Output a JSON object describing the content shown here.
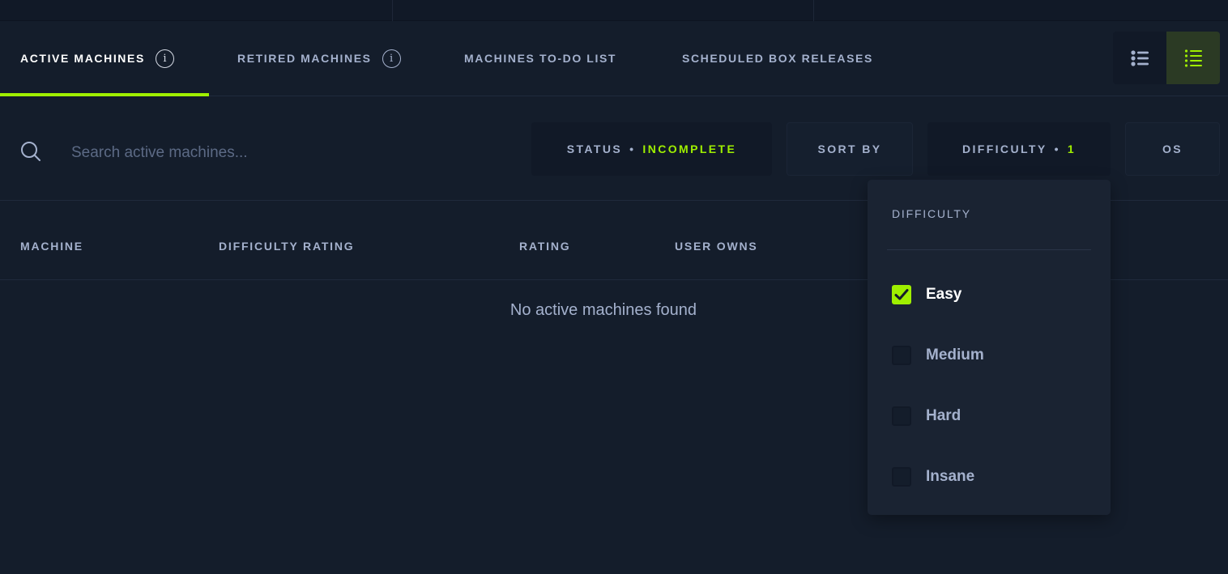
{
  "tabs": [
    {
      "label": "ACTIVE MACHINES",
      "active": true,
      "info": "i"
    },
    {
      "label": "RETIRED MACHINES",
      "active": false,
      "info": "i"
    },
    {
      "label": "MACHINES TO-DO LIST",
      "active": false
    },
    {
      "label": "SCHEDULED BOX RELEASES",
      "active": false
    }
  ],
  "view_toggle": {
    "options": [
      "list-view-icon",
      "compact-list-icon"
    ],
    "selected": "compact-list-icon"
  },
  "search": {
    "placeholder": "Search active machines...",
    "value": ""
  },
  "filters": {
    "status": {
      "label": "STATUS",
      "separator": "•",
      "value": "INCOMPLETE"
    },
    "sort": {
      "label": "SORT BY"
    },
    "difficulty": {
      "label": "DIFFICULTY",
      "separator": "•",
      "value": "1"
    },
    "os": {
      "label": "OS"
    }
  },
  "table": {
    "columns": [
      "MACHINE",
      "DIFFICULTY RATING",
      "RATING",
      "USER OWNS"
    ],
    "empty_message": "No active machines found"
  },
  "difficulty_dropdown": {
    "title": "DIFFICULTY",
    "options": [
      {
        "label": "Easy",
        "checked": true
      },
      {
        "label": "Medium",
        "checked": false
      },
      {
        "label": "Hard",
        "checked": false
      },
      {
        "label": "Insane",
        "checked": false
      }
    ]
  },
  "colors": {
    "background": "#141d2b",
    "accent": "#9fef00",
    "text": "#a4b1cd",
    "dropdown_bg": "#1a2332"
  }
}
